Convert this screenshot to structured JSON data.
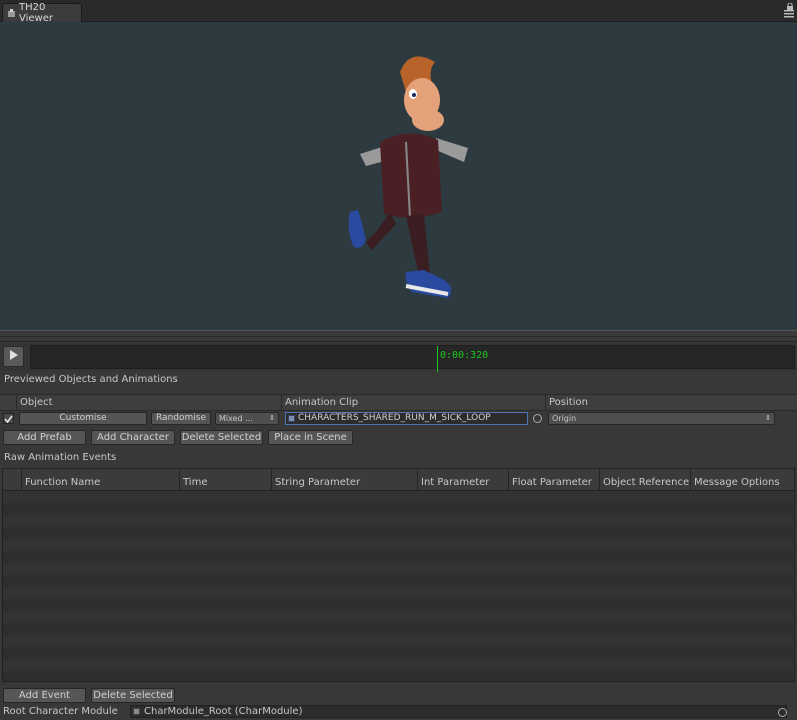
{
  "window": {
    "tab_title": "TH20 Viewer",
    "tab_icon": "unity-window-icon",
    "controls": [
      "lock-icon",
      "menu-icon"
    ]
  },
  "viewport": {
    "background_color": "#2d3a40",
    "content": "3d-character-preview"
  },
  "timeline": {
    "play_icon": "play-icon",
    "time": "0:00:320",
    "scrubber_color": "#19c81e"
  },
  "previewed": {
    "section_title": "Previewed Objects and Animations",
    "columns": [
      "Object",
      "Animation Clip",
      "Position"
    ],
    "row": {
      "enabled": true,
      "customise_label": "Customise",
      "randomise_label": "Randomise",
      "mixed_label": "Mixed ...",
      "clip_name": "CHARACTERS_SHARED_RUN_M_SICK_LOOP",
      "position_value": "Origin"
    },
    "buttons": {
      "add_prefab": "Add Prefab",
      "add_character": "Add Character",
      "delete_selected": "Delete Selected",
      "place_in_scene": "Place in Scene"
    }
  },
  "raw_events": {
    "section_title": "Raw Animation Events",
    "columns": [
      "Function Name",
      "Time",
      "String Parameter",
      "Int Parameter",
      "Float Parameter",
      "Object Reference",
      "Message Options"
    ],
    "rows": []
  },
  "footer": {
    "add_event": "Add Event",
    "delete_selected": "Delete Selected",
    "root_label": "Root Character Module",
    "root_value": "CharModule_Root (CharModule)"
  }
}
